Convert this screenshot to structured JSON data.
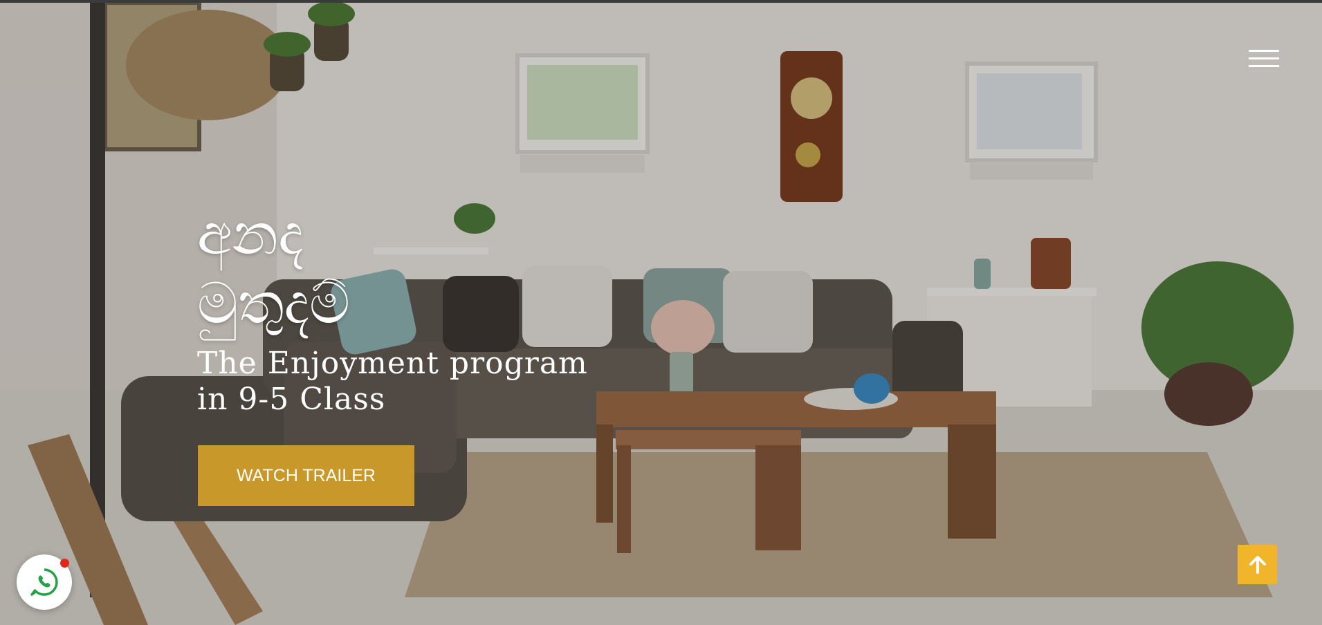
{
  "hero": {
    "background_image": "living-room-photo",
    "title": "අනද\nමුතුදම්",
    "subtitle": "The Enjoyment program\nin 9-5 Class",
    "cta_label": "WATCH TRAILER"
  },
  "nav": {
    "menu_icon": "hamburger-menu-icon"
  },
  "floating": {
    "whatsapp_icon": "whatsapp-icon",
    "notification_dot_color": "#e1261c",
    "scroll_top_icon": "arrow-up-icon"
  },
  "colors": {
    "accent": "#c9982a",
    "scroll_top_bg": "#f0b52a",
    "whatsapp_green": "#25a244"
  }
}
